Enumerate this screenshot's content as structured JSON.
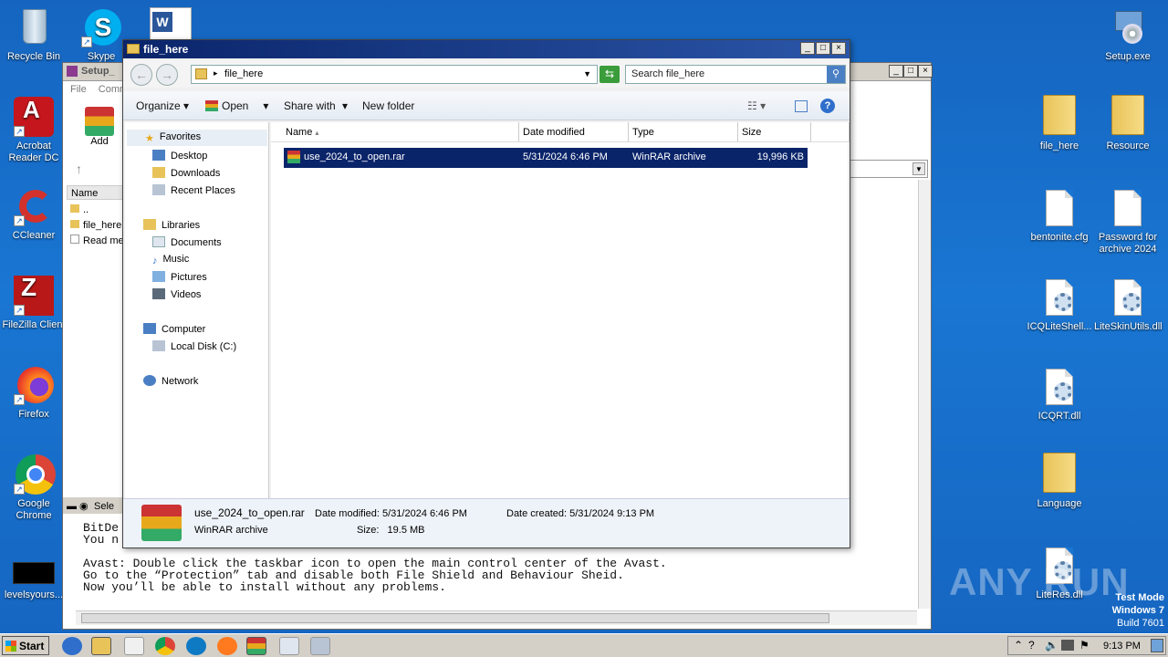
{
  "desktop": {
    "left_icons": [
      {
        "label": "Recycle Bin"
      },
      {
        "label": "Acrobat Reader DC"
      },
      {
        "label": "CCleaner"
      },
      {
        "label": "FileZilla Client"
      },
      {
        "label": "Firefox"
      },
      {
        "label": "Google Chrome"
      },
      {
        "label": "levelsyours..."
      }
    ],
    "top_icons": [
      {
        "label": "Skype"
      }
    ],
    "right_icons": [
      {
        "label": "Setup.exe"
      },
      {
        "label": "file_here"
      },
      {
        "label": "Resource"
      },
      {
        "label": "bentonite.cfg"
      },
      {
        "label": "Password for archive 2024"
      },
      {
        "label": "ICQLiteShell..."
      },
      {
        "label": "LiteSkinUtils.dll"
      },
      {
        "label": "ICQRT.dll"
      },
      {
        "label": "Language"
      },
      {
        "label": "LiteRes.dll"
      }
    ],
    "watermark": "ANY RUN",
    "test_mode": {
      "line1": "Test Mode",
      "line2": "Windows 7",
      "line3": "Build 7601"
    }
  },
  "back_window": {
    "title": "Setup_",
    "menu": [
      "File",
      "Comm"
    ],
    "add_label": "Add",
    "name_header": "Name",
    "files": [
      "..",
      "file_here",
      "Read me"
    ],
    "status": "Sele",
    "text_lines": [
      "BitDe",
      "You n",
      "",
      "Avast: Double click the taskbar icon to open the main control center of the Avast.",
      "Go to the “Protection” tab and disable both File Shield and Behaviour Sheid.",
      "Now you’ll be able to install without any problems."
    ]
  },
  "explorer": {
    "title": "file_here",
    "address": "file_here",
    "search_placeholder": "Search file_here",
    "toolbar": {
      "organize": "Organize",
      "open": "Open",
      "share_with": "Share with",
      "new_folder": "New folder"
    },
    "nav_tree": {
      "favorites": "Favorites",
      "desktop": "Desktop",
      "downloads": "Downloads",
      "recent_places": "Recent Places",
      "libraries": "Libraries",
      "documents": "Documents",
      "music": "Music",
      "pictures": "Pictures",
      "videos": "Videos",
      "computer": "Computer",
      "local_disk": "Local Disk (C:)",
      "network": "Network"
    },
    "columns": {
      "name": "Name",
      "date_modified": "Date modified",
      "type": "Type",
      "size": "Size"
    },
    "files": [
      {
        "name": "use_2024_to_open.rar",
        "date_modified": "5/31/2024 6:46 PM",
        "type": "WinRAR archive",
        "size": "19,996 KB"
      }
    ],
    "details": {
      "name": "use_2024_to_open.rar",
      "type": "WinRAR archive",
      "date_modified_label": "Date modified:",
      "date_modified": "5/31/2024 6:46 PM",
      "size_label": "Size:",
      "size": "19.5 MB",
      "date_created_label": "Date created:",
      "date_created": "5/31/2024 9:13 PM"
    }
  },
  "taskbar": {
    "start_label": "Start",
    "clock": "9:13 PM"
  }
}
